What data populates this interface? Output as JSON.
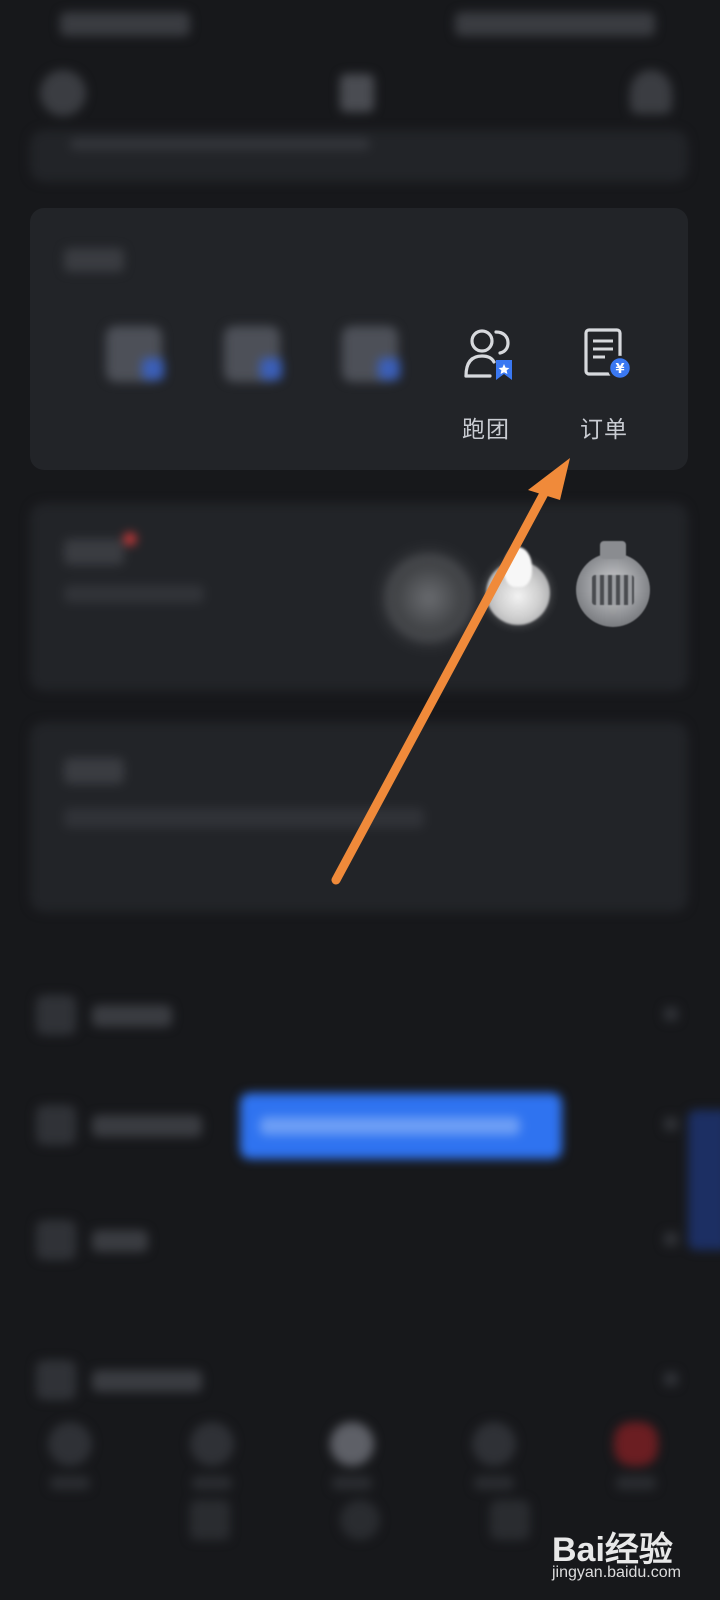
{
  "services": {
    "items": [
      {
        "label": "",
        "icon": "chat-icon"
      },
      {
        "label": "",
        "icon": "calendar-icon"
      },
      {
        "label": "",
        "icon": "route-icon"
      },
      {
        "label": "跑团",
        "icon": "group-icon"
      },
      {
        "label": "订单",
        "icon": "order-icon"
      }
    ]
  },
  "badges": {
    "medal_1_text": "",
    "notification_dot_color": "#e23b3b"
  },
  "watermark": {
    "logo": "Bai经验",
    "url": "jingyan.baidu.com"
  },
  "colors": {
    "background": "#17181b",
    "card": "#222428",
    "accent_blue": "#2f73f0",
    "arrow": "#f08a3a"
  }
}
